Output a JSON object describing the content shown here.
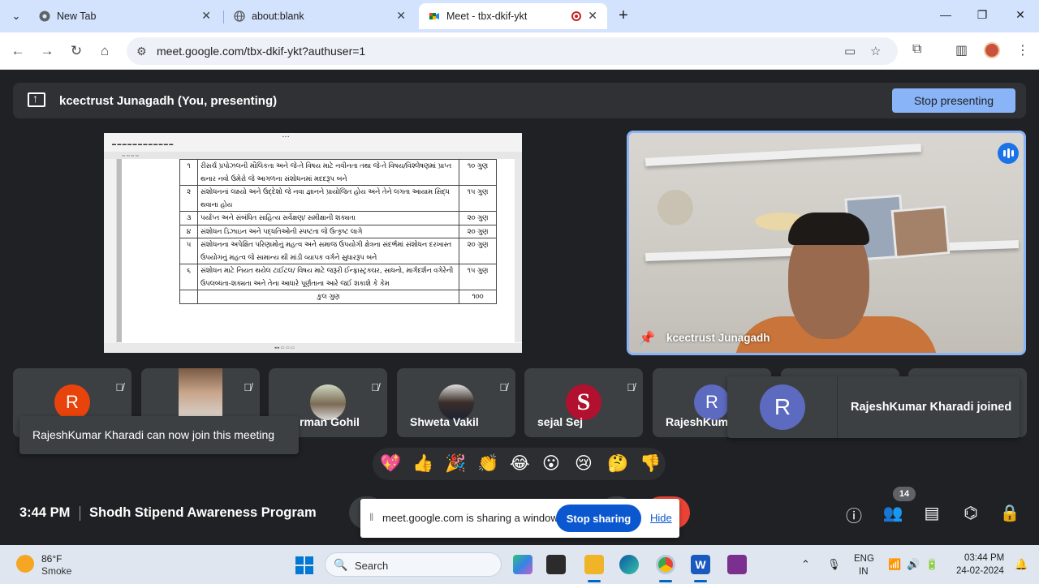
{
  "browser": {
    "tabs": [
      {
        "label": "New Tab",
        "icon": "chrome-icon"
      },
      {
        "label": "about:blank",
        "icon": "globe-icon"
      },
      {
        "label": "Meet - tbx-dkif-ykt",
        "icon": "meet-icon",
        "active": true
      }
    ],
    "url": "meet.google.com/tbx-dkif-ykt?authuser=1"
  },
  "presenting": {
    "text": "kcectrust Junagadh (You, presenting)",
    "stop_label": "Stop presenting"
  },
  "document": {
    "rows": [
      {
        "num": "૧",
        "text": "રીસર્ચ પ્રપોઝલની મૌલિકતા અને જે-તે વિષય માટે નવીનતા તથા જે-તે વિષય/વિશ્લેષણમાં પ્રાપ્ત થનાર નવો ઉમેરો જે આગળના સંશોધનમાં મદદરૂપ બને",
        "marks": "૧૦ ગુણ"
      },
      {
        "num": "૨",
        "text": "સંશોધનનાં લક્ષ્યો અને ઉદ્દેશો જે નવા જ્ઞાનને પ્રાયોજિત હોય અને તેને લગતા આયામ સિદ્ધ થવાના હોય",
        "marks": "૧૫ ગુણ"
      },
      {
        "num": "૩",
        "text": "પર્યાપ્ત અને સંબંધિત સાહિત્ય સર્વેક્ષણ/ સમીક્ષાની શક્યતા",
        "marks": "૨૦ ગુણ"
      },
      {
        "num": "૪",
        "text": "સંશોધન ડિઝાઇન અને પદ્ધતિઓની સ્પષ્ટતા જે ઉત્કૃષ્ટ લાગે",
        "marks": "૨૦ ગુણ"
      },
      {
        "num": "૫",
        "text": "સંશોધનના અપેક્ષિત પરિણામોનું મહત્વ અને સમાજ ઉપયોગી ક્ષેત્રના સંદર્ભમાં સંશોધન દરખાસ્ત ઉપયોગનું મહત્વ જે સામાન્ય થી માંડી વ્યાપક વર્ગને સુધારરૂપ બને",
        "marks": "૨૦ ગુણ"
      },
      {
        "num": "૬",
        "text": "સંશોધન માટે નિયત થયેલ ટાઈટલ/ વિષય માટે જરૂરી ઈન્ફ્રાસ્ટ્રક્ચર, સાધનો, માર્ગદર્શન વગેરેની ઉપલબ્ધતા-શક્યતા અને તેના આધારે પૂર્ણતાના આરે જઈ શકાશે કે કેમ",
        "marks": "૧૫ ગુણ"
      }
    ],
    "total_label": "કુલ ગુણ",
    "total_marks": "૧૦૦"
  },
  "video": {
    "name": "kcectrust Junagadh"
  },
  "participants": [
    {
      "name": "",
      "avatar": "R",
      "color": "#e8430a"
    },
    {
      "name": "",
      "avatar": "photo"
    },
    {
      "name": "rman Gohil",
      "avatar": "photo"
    },
    {
      "name": "Shweta Vakil",
      "avatar": "photo"
    },
    {
      "name": "sejal Sej",
      "avatar": "logo"
    },
    {
      "name": "RajeshKuma",
      "avatar": "R",
      "color": "#5c6bc0"
    }
  ],
  "toasts": {
    "can_join": "RajeshKumar Kharadi can now join this meeting",
    "joined": "RajeshKumar Kharadi joined",
    "joined_avatar": "R"
  },
  "reactions": [
    "💖",
    "👍",
    "🎉",
    "👏",
    "😂",
    "😮",
    "😢",
    "🤔",
    "👎"
  ],
  "bottom": {
    "time": "3:44 PM",
    "meeting": "Shodh Stipend Awareness Program",
    "participant_count": "14"
  },
  "share_bar": {
    "text": "meet.google.com is sharing a window.",
    "stop_label": "Stop sharing",
    "hide_label": "Hide"
  },
  "taskbar": {
    "temp": "86°F",
    "condition": "Smoke",
    "search": "Search",
    "lang": "ENG",
    "lang2": "IN",
    "time": "03:44 PM",
    "date": "24-02-2024"
  }
}
